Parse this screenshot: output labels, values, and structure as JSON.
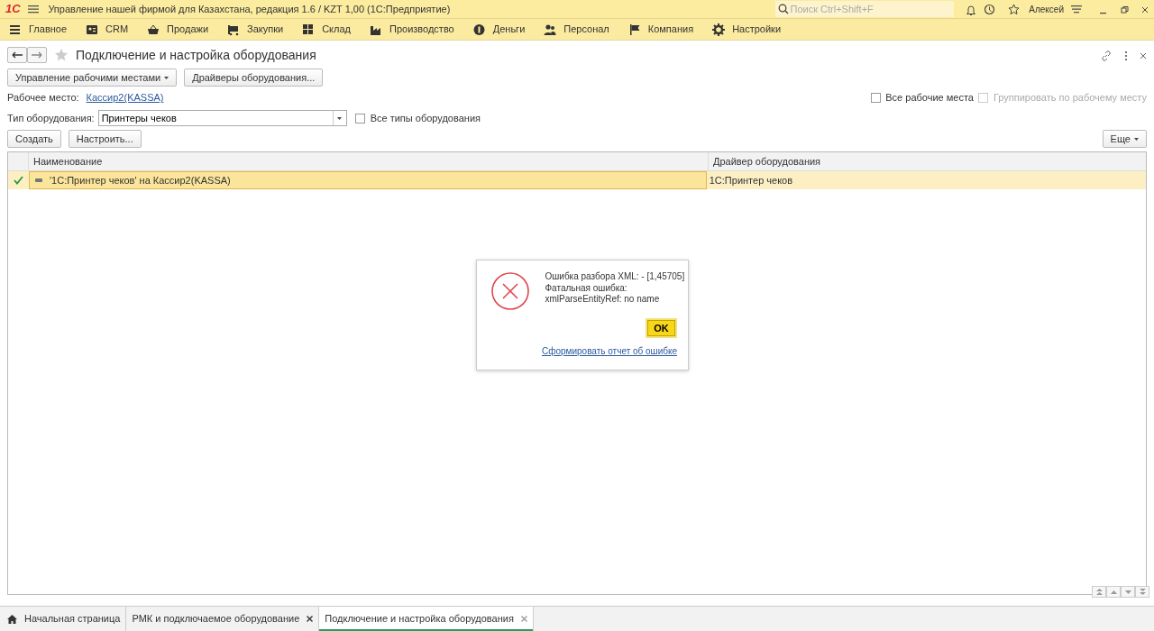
{
  "title_bar": {
    "logo": "1С",
    "title": "Управление нашей фирмой для Казахстана, редакция 1.6 / KZT 1,00  (1С:Предприятие)",
    "search": {
      "placeholder": "Поиск Ctrl+Shift+F"
    },
    "user": "Алексей"
  },
  "sections": [
    {
      "label": "Главное"
    },
    {
      "label": "CRM"
    },
    {
      "label": "Продажи"
    },
    {
      "label": "Закупки"
    },
    {
      "label": "Склад"
    },
    {
      "label": "Производство"
    },
    {
      "label": "Деньги"
    },
    {
      "label": "Персонал"
    },
    {
      "label": "Компания"
    },
    {
      "label": "Настройки"
    }
  ],
  "form": {
    "title": "Подключение и настройка оборудования",
    "favorite": false,
    "top_buttons": [
      {
        "label": "Управление рабочими местами",
        "dropdown": true
      },
      {
        "label": "Драйверы оборудования...",
        "dropdown": false
      }
    ],
    "workplace": {
      "label": "Рабочее место:",
      "value": "Кассир2(KASSA)"
    },
    "workplace_options": [
      {
        "label": "Все рабочие места",
        "checked": false,
        "disabled": false
      },
      {
        "label": "Группировать по рабочему месту",
        "checked": false,
        "disabled": true
      }
    ],
    "equipment_type": {
      "label": "Тип оборудования:",
      "value": "Принтеры чеков"
    },
    "all_types": {
      "label": "Все типы оборудования",
      "checked": false
    },
    "buttons": [
      {
        "label": "Создать"
      },
      {
        "label": "Настроить..."
      }
    ],
    "more_button": "Еще",
    "table": {
      "columns": [
        "Наименование",
        "Драйвер оборудования"
      ],
      "rows": [
        {
          "used": true,
          "selected": true,
          "name": "'1С:Принтер чеков' на Кассир2(KASSA)",
          "driver": "1С:Принтер чеков"
        }
      ]
    }
  },
  "dialog": {
    "message": [
      "Ошибка разбора XML:  - [1,45705]",
      "Фатальная ошибка:",
      "xmlParseEntityRef: no name"
    ],
    "ok_button": "OK",
    "report_link": "Сформировать отчет об ошибке"
  },
  "open_tabs": [
    {
      "label": "Начальная страница",
      "home": true,
      "closable": false,
      "selected": false
    },
    {
      "label": "РМК и подключаемое оборудование",
      "home": false,
      "closable": true,
      "selected": false
    },
    {
      "label": "Подключение и настройка оборудования",
      "home": false,
      "closable": true,
      "selected": true
    }
  ]
}
